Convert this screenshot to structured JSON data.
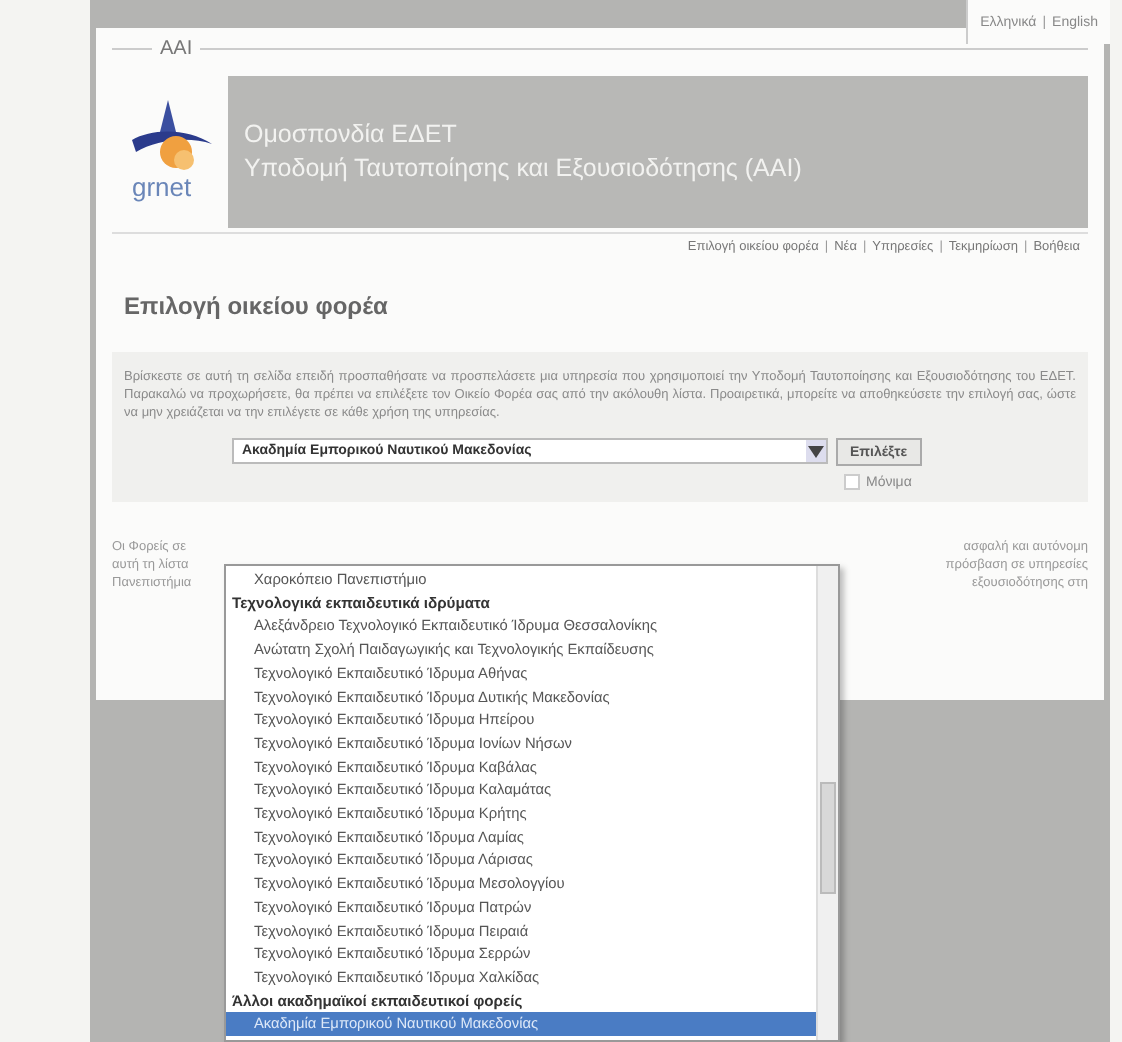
{
  "language_bar": {
    "links": [
      "Ελληνικά",
      "English"
    ],
    "separator": "|"
  },
  "section_label": "AAI",
  "logo": {
    "text": "grnet"
  },
  "banner": {
    "lines": [
      "Ομοσπονδία ΕΔΕΤ",
      "Υποδομή Ταυτοποίησης και Εξουσιοδότησης (AAI)"
    ]
  },
  "nav": {
    "links": [
      "Επιλογή οικείου φορέα",
      "Νέα",
      "Υπηρεσίες",
      "Τεκμηρίωση",
      "Βοήθεια"
    ],
    "separator": "|"
  },
  "heading": "Επιλογή οικείου φορέα",
  "intro": "Βρίσκεστε σε αυτή τη σελίδα επειδή προσπαθήσατε να προσπελάσετε μια υπηρεσία που χρησιμοποιεί την Υποδομή Ταυτοποίησης και Εξουσιοδότησης του ΕΔΕΤ. Παρακαλώ να προχωρήσετε, θα πρέπει να επιλέξετε τον Οικείο Φορέα σας από την ακόλουθη λίστα. Προαιρετικά, μπορείτε να αποθηκεύσετε την επιλογή σας, ώστε να μην χρειάζεται να την επιλέγετε σε κάθε χρήση της υπηρεσίας.",
  "select": {
    "value": "Ακαδημία Εμπορικού Ναυτικού Μακεδονίας",
    "button": "Επιλέξτε",
    "remember": {
      "label": "Μόνιμα",
      "checked": false
    }
  },
  "footer_left": [
    "Οι Φορείς σε",
    "αυτή τη λίστα",
    "Πανεπιστήμια"
  ],
  "footer_right": [
    "ασφαλή και αυτόνομη",
    "πρόσβαση σε υπηρεσίες",
    "εξουσιοδότησης στη"
  ],
  "dropdown": {
    "options": [
      {
        "kind": "option",
        "label": "Χαροκόπειο Πανεπιστήμιο",
        "selected": false
      },
      {
        "kind": "group",
        "label": "Τεχνολογικά εκπαιδευτικά ιδρύματα"
      },
      {
        "kind": "option",
        "label": "Αλεξάνδρειο Τεχνολογικό Εκπαιδευτικό Ίδρυμα Θεσσαλονίκης",
        "selected": false
      },
      {
        "kind": "option",
        "label": "Ανώτατη Σχολή Παιδαγωγικής και Τεχνολογικής Εκπαίδευσης",
        "selected": false
      },
      {
        "kind": "option",
        "label": "Τεχνολογικό Εκπαιδευτικό Ίδρυμα Αθήνας",
        "selected": false
      },
      {
        "kind": "option",
        "label": "Τεχνολογικό Εκπαιδευτικό Ίδρυμα Δυτικής Μακεδονίας",
        "selected": false
      },
      {
        "kind": "option",
        "label": "Τεχνολογικό Εκπαιδευτικό Ίδρυμα Ηπείρου",
        "selected": false
      },
      {
        "kind": "option",
        "label": "Τεχνολογικό Εκπαιδευτικό Ίδρυμα Ιονίων Νήσων",
        "selected": false
      },
      {
        "kind": "option",
        "label": "Τεχνολογικό Εκπαιδευτικό Ίδρυμα Καβάλας",
        "selected": false
      },
      {
        "kind": "option",
        "label": "Τεχνολογικό Εκπαιδευτικό Ίδρυμα Καλαμάτας",
        "selected": false
      },
      {
        "kind": "option",
        "label": "Τεχνολογικό Εκπαιδευτικό Ίδρυμα Κρήτης",
        "selected": false
      },
      {
        "kind": "option",
        "label": "Τεχνολογικό Εκπαιδευτικό Ίδρυμα Λαμίας",
        "selected": false
      },
      {
        "kind": "option",
        "label": "Τεχνολογικό Εκπαιδευτικό Ίδρυμα Λάρισας",
        "selected": false
      },
      {
        "kind": "option",
        "label": "Τεχνολογικό Εκπαιδευτικό Ίδρυμα Μεσολογγίου",
        "selected": false
      },
      {
        "kind": "option",
        "label": "Τεχνολογικό Εκπαιδευτικό Ίδρυμα Πατρών",
        "selected": false
      },
      {
        "kind": "option",
        "label": "Τεχνολογικό Εκπαιδευτικό Ίδρυμα Πειραιά",
        "selected": false
      },
      {
        "kind": "option",
        "label": "Τεχνολογικό Εκπαιδευτικό Ίδρυμα Σερρών",
        "selected": false
      },
      {
        "kind": "option",
        "label": "Τεχνολογικό Εκπαιδευτικό Ίδρυμα Χαλκίδας",
        "selected": false
      },
      {
        "kind": "group",
        "label": "Άλλοι ακαδημαϊκοί εκπαιδευτικοί φορείς"
      },
      {
        "kind": "option",
        "label": "Ακαδημία Εμπορικού Ναυτικού Μακεδονίας",
        "selected": true
      }
    ]
  }
}
